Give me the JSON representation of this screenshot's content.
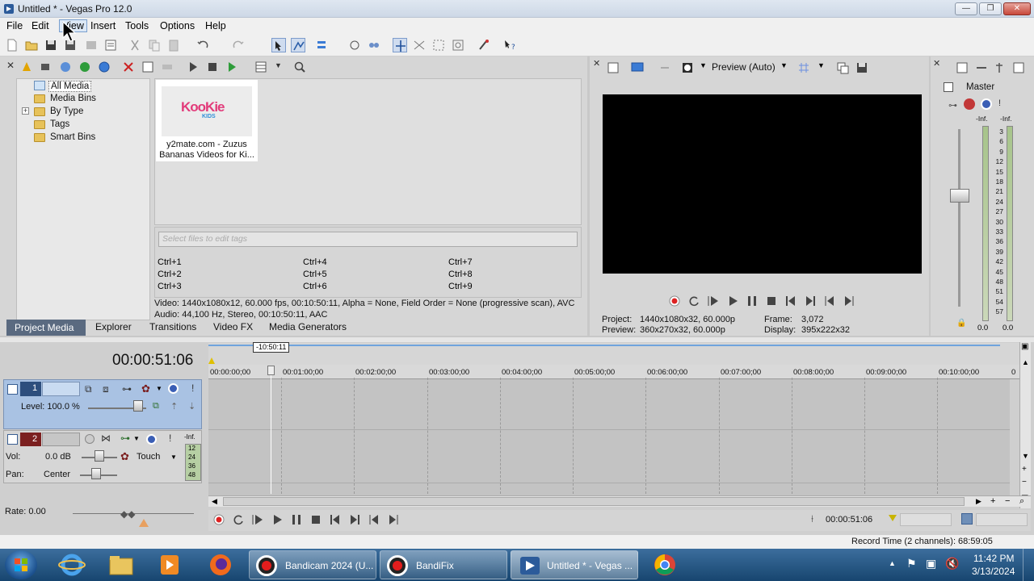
{
  "window": {
    "title": "Untitled * - Vegas Pro 12.0",
    "controls": {
      "minimize": "—",
      "maximize": "❐",
      "close": "✕"
    }
  },
  "menu": [
    "File",
    "Edit",
    "View",
    "Insert",
    "Tools",
    "Options",
    "Help"
  ],
  "media_tree": {
    "items": [
      "All Media",
      "Media Bins",
      "By Type",
      "Tags",
      "Smart Bins"
    ],
    "expander": "+"
  },
  "media_file": {
    "logo": "KooKie",
    "logo_sub": "KIDS",
    "caption_line1": "y2mate.com - Zuzus",
    "caption_line2": "Bananas  Videos for Ki..."
  },
  "tags": {
    "placeholder": "Select files to edit tags",
    "shortcuts": [
      "Ctrl+1",
      "Ctrl+4",
      "Ctrl+7",
      "Ctrl+2",
      "Ctrl+5",
      "Ctrl+8",
      "Ctrl+3",
      "Ctrl+6",
      "Ctrl+9"
    ]
  },
  "media_info": {
    "video": "Video: 1440x1080x12, 60.000 fps, 00:10:50:11, Alpha = None, Field Order = None (progressive scan), AVC",
    "audio": "Audio: 44,100 Hz, Stereo, 00:10:50:11, AAC"
  },
  "window_tabs": [
    "Project Media",
    "Explorer",
    "Transitions",
    "Video FX",
    "Media Generators"
  ],
  "preview": {
    "mode": "Preview (Auto)",
    "project_label": "Project:",
    "project_value": "1440x1080x32, 60.000p",
    "preview_label": "Preview:",
    "preview_value": "360x270x32, 60.000p",
    "frame_label": "Frame:",
    "frame_value": "3,072",
    "display_label": "Display:",
    "display_value": "395x222x32"
  },
  "master": {
    "label": "Master",
    "inf_left": "-Inf.",
    "inf_right": "-Inf.",
    "scale": [
      "3",
      "6",
      "9",
      "12",
      "15",
      "18",
      "21",
      "24",
      "27",
      "30",
      "33",
      "36",
      "39",
      "42",
      "45",
      "48",
      "51",
      "54",
      "57"
    ],
    "bottom_left": "0.0",
    "bottom_right": "0.0"
  },
  "timeline": {
    "time_display": "00:00:51:06",
    "marker": "-10:50:11",
    "ruler": [
      "00:00:00;00",
      "00:01:00;00",
      "00:02:00;00",
      "00:03:00;00",
      "00:04:00;00",
      "00:05:00;00",
      "00:06:00;00",
      "00:07:00;00",
      "00:08:00;00",
      "00:09:00;00",
      "00:10:00;00",
      "0"
    ],
    "video_track": {
      "number": "1",
      "level_label": "Level: 100.0 %"
    },
    "audio_track": {
      "number": "2",
      "vol_label": "Vol:",
      "vol_value": "0.0 dB",
      "pan_label": "Pan:",
      "pan_value": "Center",
      "automation": "Touch",
      "meter": [
        "-Inf.",
        "12",
        "24",
        "36",
        "48"
      ]
    },
    "rate": "Rate: 0.00",
    "cursor_time": "00:00:51:06",
    "record_time": "Record Time (2 channels): 68:59:05"
  },
  "taskbar": {
    "buttons": [
      {
        "label": "Bandicam 2024 (U..."
      },
      {
        "label": "BandiFix"
      },
      {
        "label": "Untitled * - Vegas ..."
      }
    ],
    "time": "11:42 PM",
    "date": "3/13/2024"
  },
  "colors": {
    "accent": "#3f6fb0",
    "track_header": "#a9c2e3",
    "taskbar": "#1f4d79"
  }
}
